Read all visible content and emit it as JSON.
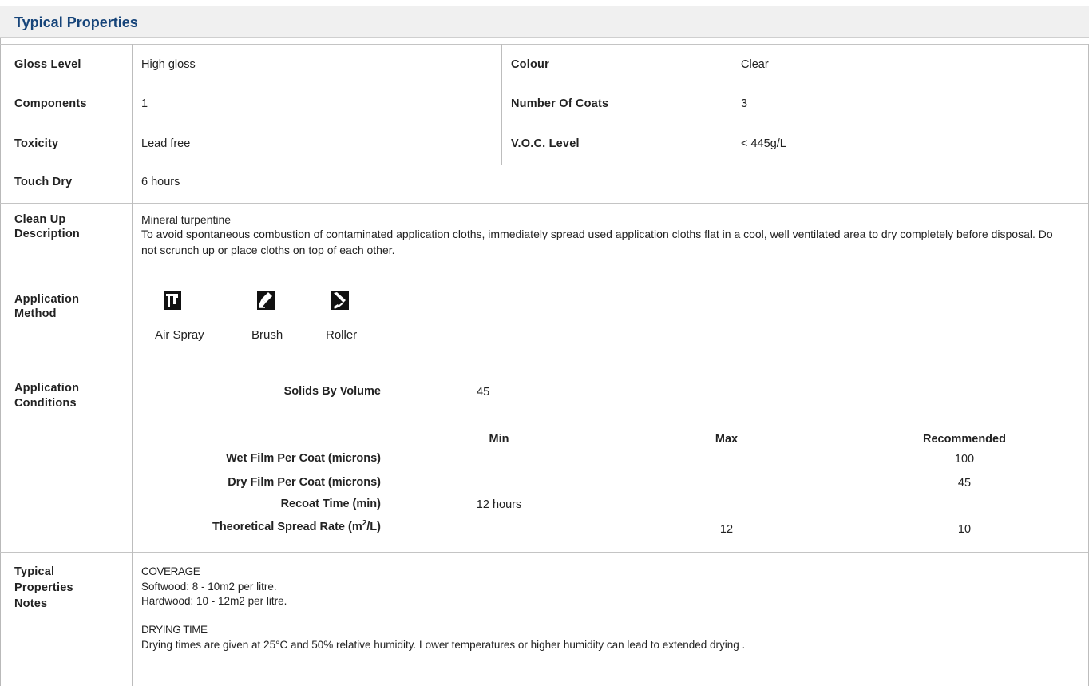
{
  "title": "Typical Properties",
  "rows": {
    "gloss_label": "Gloss Level",
    "gloss_value": "High gloss",
    "colour_label": "Colour",
    "colour_value": "Clear",
    "components_label": "Components",
    "components_value": "1",
    "coats_label": "Number Of Coats",
    "coats_value": "3",
    "toxicity_label": "Toxicity",
    "toxicity_value": "Lead free",
    "voc_label": "V.O.C. Level",
    "voc_value": "< 445g/L",
    "touchdry_label": "Touch Dry",
    "touchdry_value": "6 hours",
    "cleanup_label_1": "Clean Up",
    "cleanup_label_2": "Description",
    "cleanup_line_1": "Mineral turpentine",
    "cleanup_line_2": "To avoid spontaneous combustion of contaminated application cloths, immediately spread used application cloths flat in a cool, well ventilated area to dry completely before disposal. Do not scrunch up or place cloths on top of each other.",
    "method_label_1": "Application",
    "method_label_2": "Method",
    "methods": [
      {
        "label": "Air Spray",
        "icon": "air-spray-icon"
      },
      {
        "label": "Brush",
        "icon": "brush-icon"
      },
      {
        "label": "Roller",
        "icon": "roller-icon"
      }
    ],
    "conditions_label_1": "Application",
    "conditions_label_2": "Conditions",
    "notes_label_1": "Typical",
    "notes_label_2": "Properties",
    "notes_label_3": "Notes"
  },
  "conditions": {
    "solids_label": "Solids By Volume",
    "solids_value": "45",
    "col_min": "Min",
    "col_max": "Max",
    "col_recommended": "Recommended",
    "wet_label": "Wet Film Per Coat (microns)",
    "wet_recommended": "100",
    "dry_label": "Dry Film Per Coat (microns)",
    "dry_recommended": "45",
    "recoat_label": "Recoat Time (min)",
    "recoat_min": "12 hours",
    "spread_label_pre": "Theoretical Spread Rate (m",
    "spread_label_sup": "2",
    "spread_label_post": "/L)",
    "spread_max": "12",
    "spread_recommended": "10"
  },
  "notes": {
    "coverage_heading": "COVERAGE",
    "softwood": "Softwood: 8 - 10m2 per litre.",
    "hardwood": "Hardwood: 10 - 12m2 per litre.",
    "drying_heading": "DRYING TIME",
    "drying_text": "Drying times are given at 25°C and 50% relative humidity. Lower temperatures or higher humidity can lead to extended drying ."
  }
}
